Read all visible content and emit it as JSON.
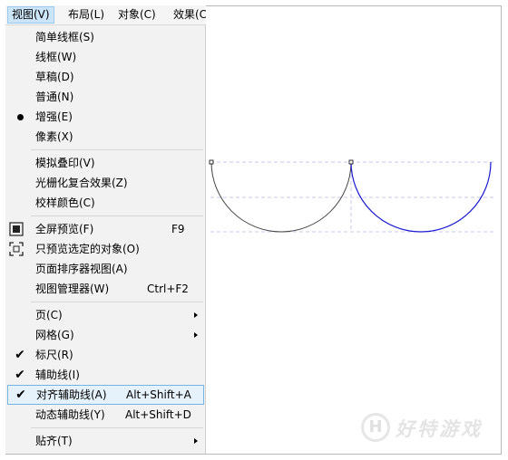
{
  "menubar": {
    "items": [
      {
        "label": "视图(V)",
        "active": true
      },
      {
        "label": "布局(L)"
      },
      {
        "label": "对象(C)"
      },
      {
        "label": "效果(C)"
      }
    ]
  },
  "dropdown": {
    "items": [
      {
        "label": "简单线框(S)"
      },
      {
        "label": "线框(W)"
      },
      {
        "label": "草稿(D)"
      },
      {
        "label": "普通(N)"
      },
      {
        "label": "增强(E)",
        "mark": "bullet"
      },
      {
        "label": "像素(X)"
      },
      {
        "label": "模拟叠印(V)"
      },
      {
        "label": "光栅化复合效果(Z)"
      },
      {
        "label": "校样颜色(C)"
      },
      {
        "label": "全屏预览(F)",
        "shortcut": "F9",
        "icon": "fullscreen-icon"
      },
      {
        "label": "只预览选定的对象(O)",
        "icon": "preview-selected-icon"
      },
      {
        "label": "页面排序器视图(A)"
      },
      {
        "label": "视图管理器(W)",
        "shortcut": "Ctrl+F2"
      },
      {
        "label": "页(C)",
        "submenu": true
      },
      {
        "label": "网格(G)",
        "submenu": true
      },
      {
        "label": "标尺(R)",
        "mark": "check"
      },
      {
        "label": "辅助线(I)",
        "mark": "check"
      },
      {
        "label": "对齐辅助线(A)",
        "shortcut": "Alt+Shift+A",
        "mark": "check",
        "highlighted": true
      },
      {
        "label": "动态辅助线(Y)",
        "shortcut": "Alt+Shift+D"
      },
      {
        "label": "贴齐(T)",
        "submenu": true
      }
    ]
  },
  "canvas": {
    "left_arc_color": "#444444",
    "right_arc_color": "#1a1ad0",
    "guide_color": "#c8c8f0"
  },
  "watermark": {
    "logo_letter": "H",
    "text": "好特游戏"
  },
  "colors": {
    "highlight_bg": "#e5f1fb",
    "highlight_border": "#72b4e2",
    "menu_bg": "#f2f2f2"
  }
}
